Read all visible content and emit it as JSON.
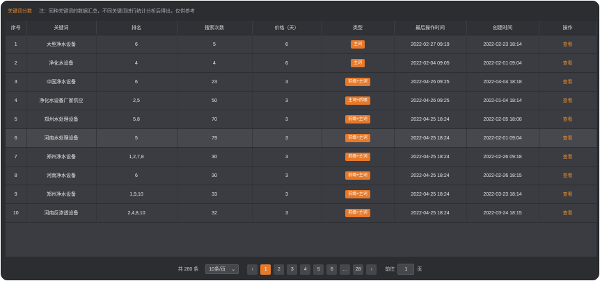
{
  "header": {
    "title": "关键词分数",
    "note": "注：同种关键词的数据汇总，不同关键词进行统计分析后得出，仅供参考"
  },
  "table": {
    "columns": [
      "序号",
      "关键词",
      "排名",
      "搜索次数",
      "价格（天）",
      "类型",
      "最后操作时间",
      "创建时间",
      "操作"
    ],
    "rows": [
      {
        "no": "1",
        "kw": "大型净水设备",
        "rank": "6",
        "times": "5",
        "price": "6",
        "type": "主词",
        "last": "2022-02-27 09:19",
        "created": "2022-02-23 18:14",
        "op": "查看"
      },
      {
        "no": "2",
        "kw": "净化水设备",
        "rank": "4",
        "times": "4",
        "price": "6",
        "type": "主词",
        "last": "2022-02-04 09:05",
        "created": "2022-02-01 09:04",
        "op": "查看"
      },
      {
        "no": "3",
        "kw": "中国净水设备",
        "rank": "6",
        "times": "23",
        "price": "3",
        "type": "前缀+主词",
        "last": "2022-04-26 09:25",
        "created": "2022-04-04 18:18",
        "op": "查看"
      },
      {
        "no": "4",
        "kw": "净化水设备厂家供应",
        "rank": "2,5",
        "times": "50",
        "price": "3",
        "type": "主词+后缀",
        "last": "2022-04-26 09:25",
        "created": "2022-01-04 18:14",
        "op": "查看"
      },
      {
        "no": "5",
        "kw": "郑州水处理设备",
        "rank": "5,8",
        "times": "70",
        "price": "3",
        "type": "前缀+主词",
        "last": "2022-04-25 18:24",
        "created": "2022-02-05 18:08",
        "op": "查看"
      },
      {
        "no": "6",
        "kw": "河南水处理设备",
        "rank": "5",
        "times": "79",
        "price": "3",
        "type": "前缀+主词",
        "last": "2022-04-25 18:24",
        "created": "2022-02-01 09:04",
        "op": "查看"
      },
      {
        "no": "7",
        "kw": "郑州净水设备",
        "rank": "1,2,7,8",
        "times": "30",
        "price": "3",
        "type": "前缀+主词",
        "last": "2022-04-25 18:24",
        "created": "2022-02-26 09:18",
        "op": "查看"
      },
      {
        "no": "8",
        "kw": "河南净水设备",
        "rank": "6",
        "times": "30",
        "price": "3",
        "type": "前缀+主词",
        "last": "2022-04-25 18:24",
        "created": "2022-02-26 18:15",
        "op": "查看"
      },
      {
        "no": "9",
        "kw": "郑州净水设备",
        "rank": "1,9,10",
        "times": "33",
        "price": "3",
        "type": "前缀+主词",
        "last": "2022-04-25 18:24",
        "created": "2022-03-23 18:14",
        "op": "查看"
      },
      {
        "no": "10",
        "kw": "河南反渗透设备",
        "rank": "2,4,8,10",
        "times": "32",
        "price": "3",
        "type": "前缀+主词",
        "last": "2022-04-25 18:24",
        "created": "2022-03-24 18:15",
        "op": "查看"
      }
    ]
  },
  "pager": {
    "total": "共 280 条",
    "size": "10条/页",
    "pages": [
      "1",
      "2",
      "3",
      "4",
      "5",
      "6",
      "…",
      "28"
    ],
    "prev": "‹",
    "next": "›",
    "goto_label": "前往",
    "goto_value": "1",
    "goto_suffix": "页"
  },
  "colors": {
    "accent": "#e6792a",
    "bg": "#2b2d31",
    "table": "#3a3c41"
  }
}
